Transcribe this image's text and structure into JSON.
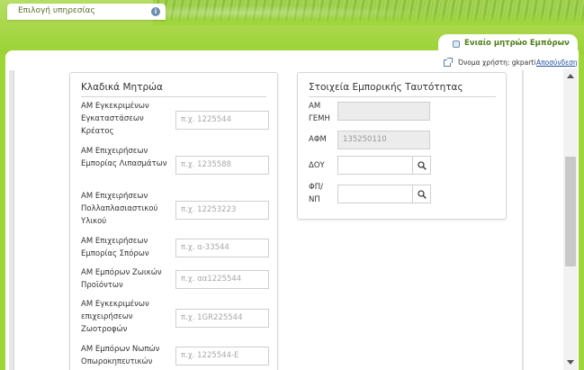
{
  "header": {
    "service_tab_label": "Επιλογή υπηρεσίας",
    "service_info_icon": "info-icon",
    "registry_tab_label": "Ενιαίο μητρώο Εμπόρων",
    "registry_icon": "collapse-icon"
  },
  "user_bar": {
    "user_text": "Όνομα χρήστη: gkparti",
    "logout_label": "Αποσύνδεση"
  },
  "sector_registries": {
    "title": "Κλαδικά Μητρώα",
    "fields": [
      {
        "label": "ΑΜ Εγκεκριμένων Εγκαταστάσεων Κρέατος",
        "placeholder": "π.χ. 1225544"
      },
      {
        "label": "ΑΜ Επιχειρήσεων Εμπορίας Λιπασμάτων",
        "placeholder": "π.χ. 1235588"
      },
      {
        "label": "ΑΜ Επιχειρήσεων Πολλαπλασιαστικού Υλικού",
        "placeholder": "π.χ. 12253223"
      },
      {
        "label": "ΑΜ Επιχειρήσεων Εμπορίας Σπόρων",
        "placeholder": "π.χ. α-33544"
      },
      {
        "label": "ΑΜ Εμπόρων Ζωικών Προϊόντων",
        "placeholder": "π.χ. αα1225544"
      },
      {
        "label": "ΑΜ Εγκεκριμένων επιχειρήσεων Ζωοτροφών",
        "placeholder": "π.χ. 1GR225544"
      },
      {
        "label": "ΑΜ Εμπόρων Νωπών Οπωροκηπευτικών",
        "placeholder": "π.χ. 1225544-Ε"
      }
    ]
  },
  "trade_identity": {
    "title": "Στοιχεία Εμπορικής Ταυτότητας",
    "gemh_label": "ΑΜ ΓΕΜΗ",
    "gemh_value": "",
    "afm_label": "ΑΦΜ",
    "afm_value": "135250110",
    "doy_label": "ΔΟΥ",
    "doy_value": "",
    "fpnp_label": "ΦΠ/ΝΠ",
    "fpnp_value": ""
  },
  "colors": {
    "brand_green": "#9ed638",
    "link_blue": "#1f4fa0"
  }
}
